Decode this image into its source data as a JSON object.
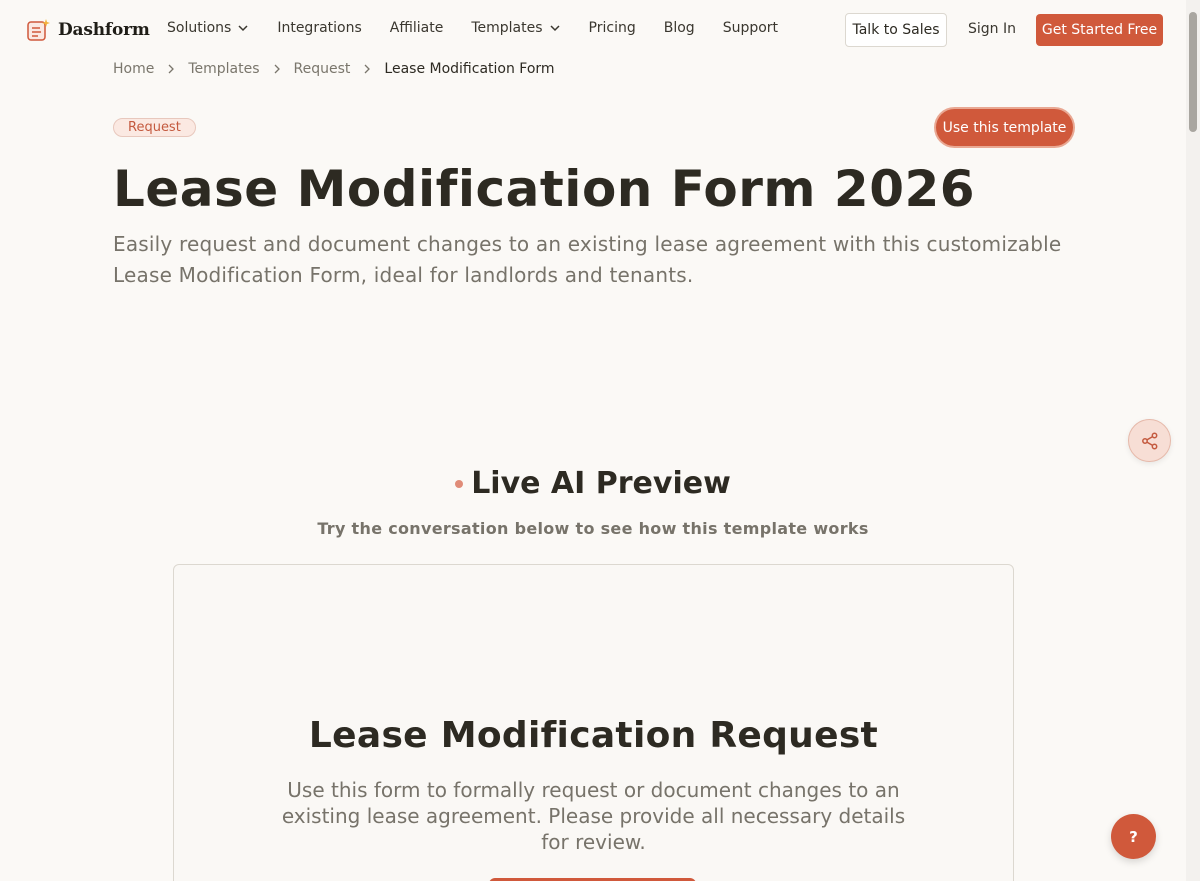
{
  "header": {
    "brand": "Dashform",
    "nav": [
      {
        "label": "Solutions",
        "dropdown": true
      },
      {
        "label": "Integrations",
        "dropdown": false
      },
      {
        "label": "Affiliate",
        "dropdown": false
      },
      {
        "label": "Templates",
        "dropdown": true
      },
      {
        "label": "Pricing",
        "dropdown": false
      },
      {
        "label": "Blog",
        "dropdown": false
      },
      {
        "label": "Support",
        "dropdown": false
      }
    ],
    "talk_to_sales": "Talk to Sales",
    "sign_in": "Sign In",
    "get_started": "Get Started Free"
  },
  "breadcrumb": [
    "Home",
    "Templates",
    "Request",
    "Lease Modification Form"
  ],
  "hero": {
    "tag": "Request",
    "use_template": "Use this template",
    "title": "Lease Modification Form 2026",
    "description": "Easily request and document changes to an existing lease agreement with this customizable Lease Modification Form, ideal for landlords and tenants."
  },
  "preview": {
    "title": "Live AI Preview",
    "subtitle": "Try the conversation below to see how this template works",
    "form_title": "Lease Modification Request",
    "form_description": "Use this form to formally request or document changes to an existing lease agreement. Please provide all necessary details for review."
  },
  "floating": {
    "share_icon": "share-icon",
    "help_label": "?"
  },
  "colors": {
    "accent": "#d0593b",
    "background": "#fbf9f6",
    "text": "#2d2a22",
    "muted": "#77736a"
  }
}
